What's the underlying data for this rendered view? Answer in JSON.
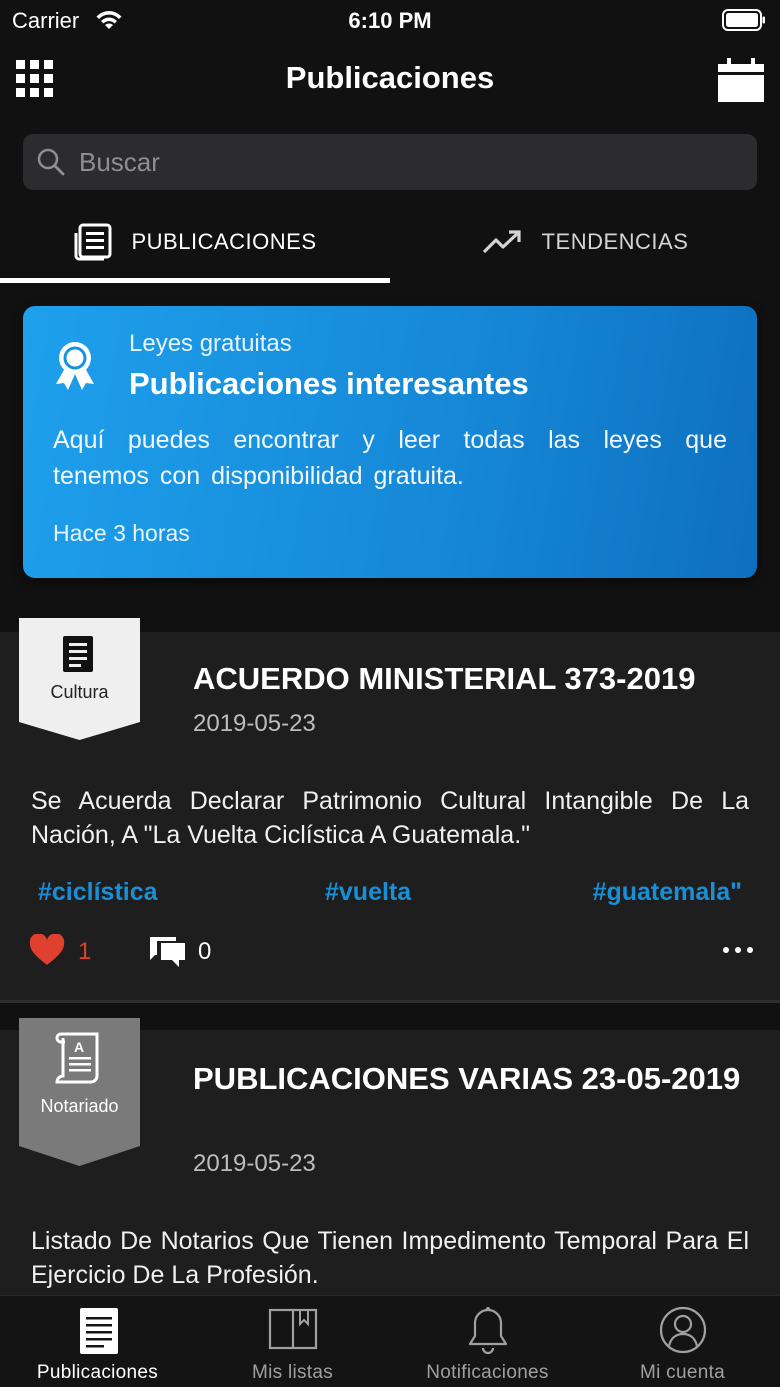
{
  "status_bar": {
    "carrier": "Carrier",
    "time": "6:10 PM"
  },
  "nav": {
    "title": "Publicaciones"
  },
  "search": {
    "placeholder": "Buscar",
    "value": ""
  },
  "tabs": [
    {
      "label": "PUBLICACIONES",
      "icon": "newspaper-icon",
      "active": true
    },
    {
      "label": "TENDENCIAS",
      "icon": "trending-icon",
      "active": false
    }
  ],
  "featured": {
    "subtitle": "Leyes gratuitas",
    "title": "Publicaciones interesantes",
    "body": "Aquí puedes encontrar y leer todas las leyes que tenemos con disponibilidad gratuita.",
    "time": "Hace 3 horas",
    "icon": "award-ribbon-icon"
  },
  "posts": [
    {
      "category": "Cultura",
      "category_icon": "document-icon",
      "title": "ACUERDO MINISTERIAL 373-2019",
      "date": "2019-05-23",
      "description": "Se Acuerda Declarar Patrimonio Cultural Intangible De La Nación, A \"La Vuelta Ciclística A Guatemala.\"",
      "hashtags": [
        "#ciclística",
        "#vuelta",
        "#guatemala\""
      ],
      "likes": "1",
      "comments": "0"
    },
    {
      "category": "Notariado",
      "category_icon": "notary-scroll-icon",
      "title": "PUBLICACIONES VARIAS 23-05-2019",
      "date": "2019-05-23",
      "description": "Listado De Notarios Que Tienen Impedimento Temporal Para El Ejercicio De La Profesión."
    }
  ],
  "tab_bar": [
    {
      "label": "Publicaciones",
      "icon": "document-list-icon",
      "active": true
    },
    {
      "label": "Mis listas",
      "icon": "book-bookmark-icon",
      "active": false
    },
    {
      "label": "Notificaciones",
      "icon": "bell-icon",
      "active": false
    },
    {
      "label": "Mi cuenta",
      "icon": "user-circle-icon",
      "active": false
    }
  ],
  "colors": {
    "accent": "#1a8fd6",
    "like": "#e0402e",
    "background": "#111111"
  }
}
